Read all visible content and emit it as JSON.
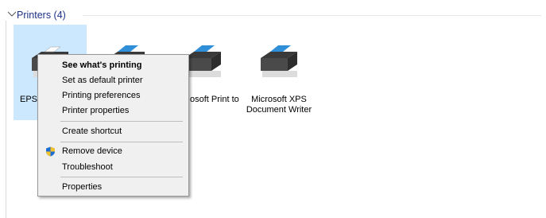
{
  "group": {
    "title": "Printers (4)"
  },
  "printers": [
    {
      "label": "EPSC"
    },
    {
      "label": ""
    },
    {
      "label": "osoft Print to"
    },
    {
      "label": "Microsoft XPS\nDocument Writer"
    }
  ],
  "context_menu": {
    "items": [
      "See what's printing",
      "Set as default printer",
      "Printing preferences",
      "Printer properties",
      "Create shortcut",
      "Remove device",
      "Troubleshoot",
      "Properties"
    ]
  },
  "colors": {
    "selection": "#cce8ff",
    "group_title": "#1e3287",
    "menu_bg": "#f0f0f0"
  }
}
